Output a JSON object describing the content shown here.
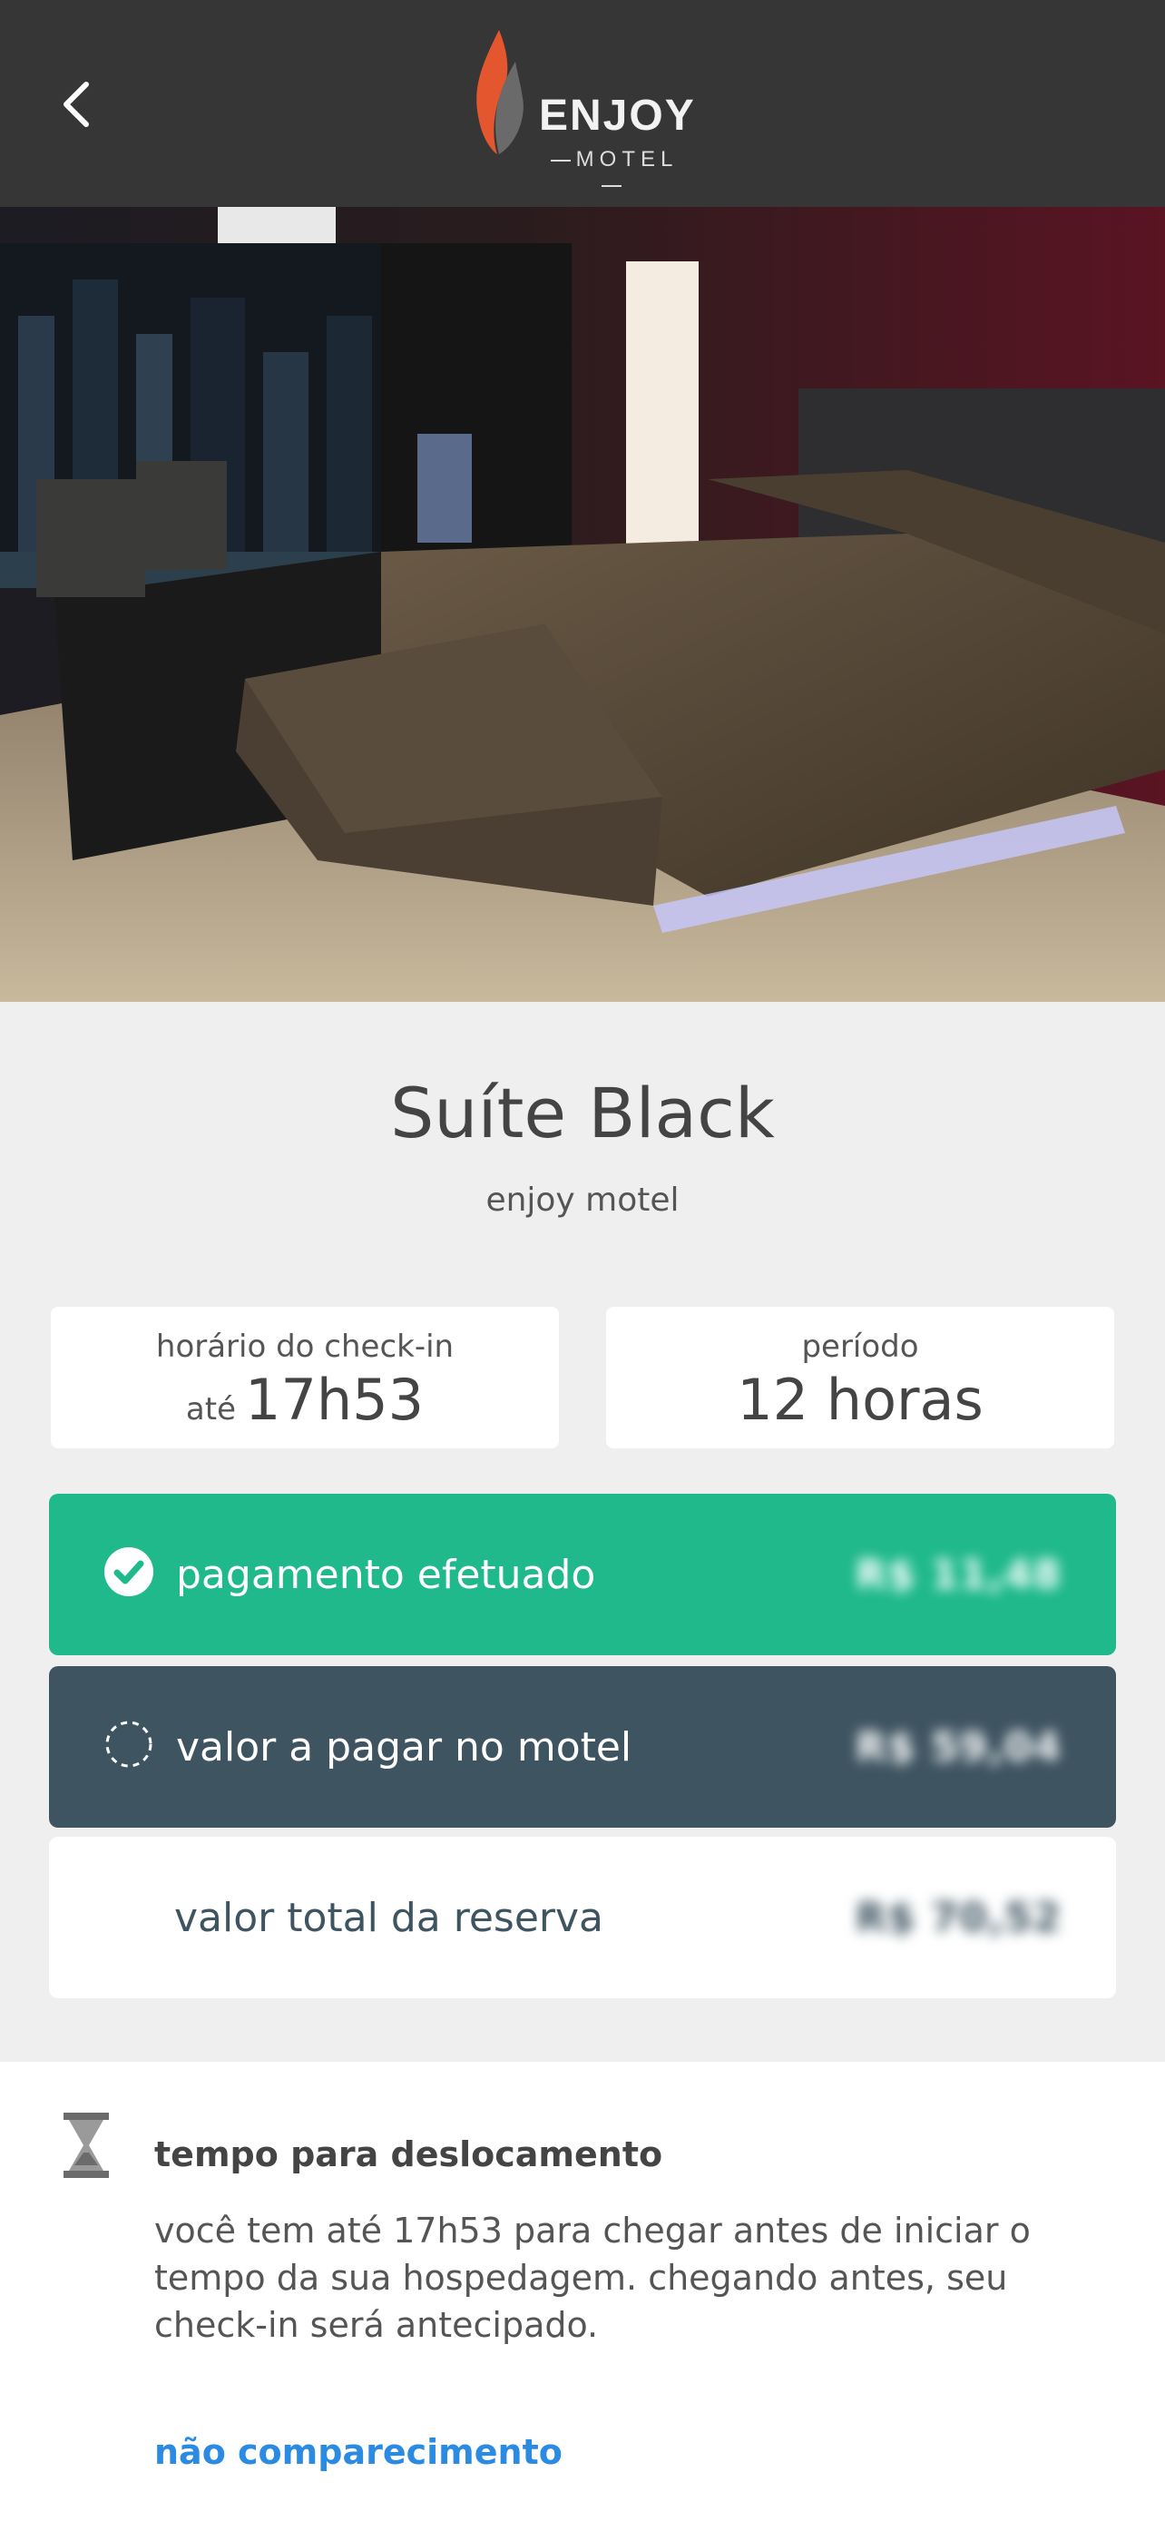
{
  "header": {
    "back_icon": "chevron-left-icon",
    "logo_main": "ENJOY",
    "logo_sub": "MOTEL",
    "logo_colors": {
      "flame": "#e4572e",
      "dark": "#555555"
    }
  },
  "suite": {
    "name": "Suíte Black",
    "motel": "enjoy motel"
  },
  "checkin": {
    "label": "horário do check-in",
    "prefix": "até",
    "time": "17h53"
  },
  "period": {
    "label": "período",
    "value": "12 horas"
  },
  "payments": [
    {
      "icon": "check-circle-icon",
      "label": "pagamento efetuado",
      "amount": "R$ 11,48",
      "color": "#1fb98b"
    },
    {
      "icon": "dashed-circle-icon",
      "label": "valor a pagar no motel",
      "amount": "R$ 59,04",
      "color": "#3e5461"
    },
    {
      "label": "valor total da reserva",
      "amount": "R$ 70,52",
      "color": "#ffffff"
    }
  ],
  "travel": {
    "icon": "hourglass-icon",
    "title": "tempo para deslocamento",
    "text": "você tem até 17h53 para chegar antes de iniciar o tempo da sua hospedagem. chegando antes, seu check-in será antecipado.",
    "noshow_link": "não comparecimento",
    "link_color": "#2b8ae2"
  }
}
